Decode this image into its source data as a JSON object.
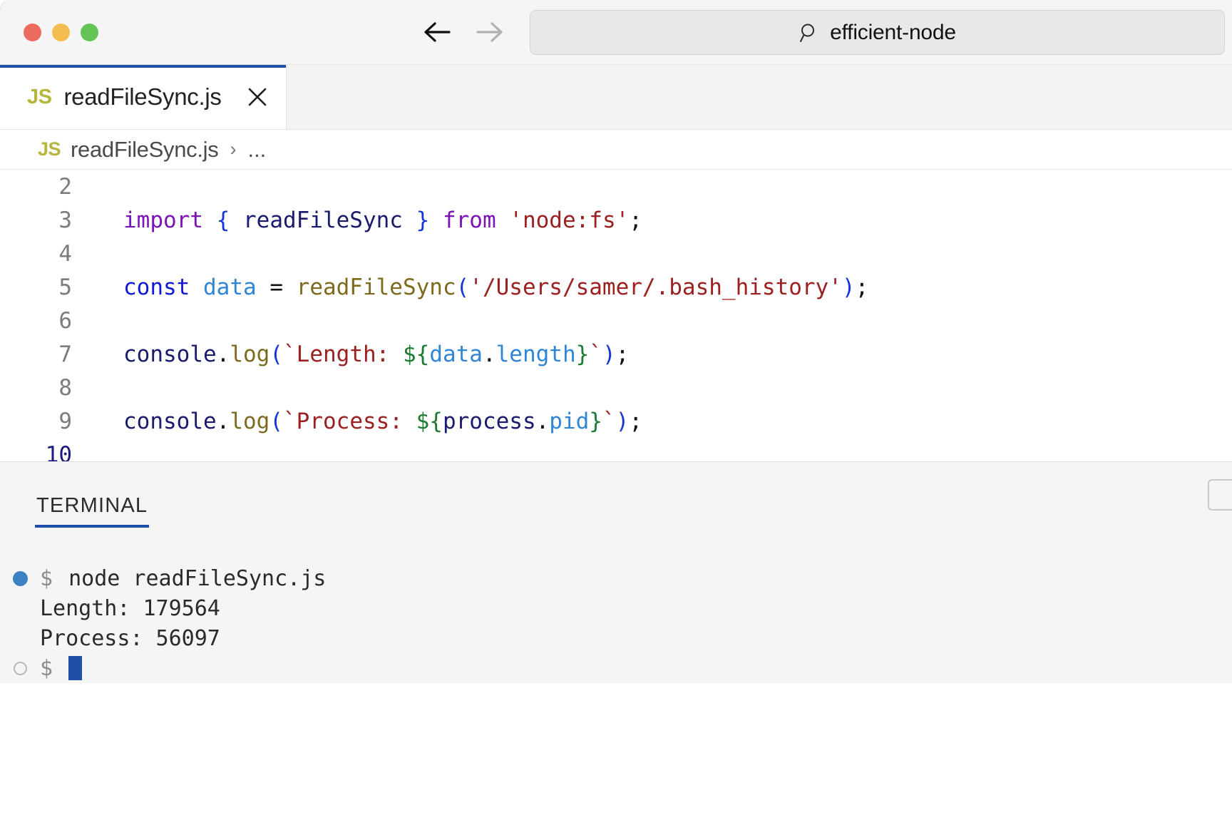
{
  "window": {
    "traffic_lights": [
      "close",
      "minimize",
      "maximize"
    ],
    "colors": {
      "close": "#ed6a5e",
      "minimize": "#f4bd4f",
      "maximize": "#61c454",
      "accent_blue": "#1f4fa8",
      "js_badge": "#b5b63b"
    }
  },
  "toolbar": {
    "back_icon": "arrow-left-icon",
    "forward_icon": "arrow-right-icon",
    "search": {
      "icon": "search-icon",
      "value": "efficient-node",
      "placeholder": "Search"
    }
  },
  "tabs": [
    {
      "icon_label": "JS",
      "label": "readFileSync.js",
      "close_icon": "close-icon",
      "active": true
    }
  ],
  "breadcrumb": {
    "icon_label": "JS",
    "file": "readFileSync.js",
    "separator": "›",
    "overflow": "..."
  },
  "editor": {
    "lines": [
      {
        "number": "2",
        "active": false,
        "tokens": []
      },
      {
        "number": "3",
        "active": false,
        "tokens": [
          {
            "t": "import",
            "c": "kw"
          },
          {
            "t": " ",
            "c": "plain"
          },
          {
            "t": "{",
            "c": "brace"
          },
          {
            "t": " ",
            "c": "plain"
          },
          {
            "t": "readFileSync",
            "c": "ident"
          },
          {
            "t": " ",
            "c": "plain"
          },
          {
            "t": "}",
            "c": "brace"
          },
          {
            "t": " ",
            "c": "plain"
          },
          {
            "t": "from",
            "c": "kw"
          },
          {
            "t": " ",
            "c": "plain"
          },
          {
            "t": "'node:fs'",
            "c": "str"
          },
          {
            "t": ";",
            "c": "plain"
          }
        ]
      },
      {
        "number": "4",
        "active": false,
        "tokens": []
      },
      {
        "number": "5",
        "active": false,
        "tokens": [
          {
            "t": "const",
            "c": "kw2"
          },
          {
            "t": " ",
            "c": "plain"
          },
          {
            "t": "data",
            "c": "var"
          },
          {
            "t": " = ",
            "c": "plain"
          },
          {
            "t": "readFileSync",
            "c": "fn"
          },
          {
            "t": "(",
            "c": "brace"
          },
          {
            "t": "'/Users/samer/.bash_history'",
            "c": "str"
          },
          {
            "t": ")",
            "c": "brace"
          },
          {
            "t": ";",
            "c": "plain"
          }
        ]
      },
      {
        "number": "6",
        "active": false,
        "tokens": []
      },
      {
        "number": "7",
        "active": false,
        "tokens": [
          {
            "t": "console",
            "c": "ident"
          },
          {
            "t": ".",
            "c": "plain"
          },
          {
            "t": "log",
            "c": "fn"
          },
          {
            "t": "(",
            "c": "brace"
          },
          {
            "t": "`Length: ",
            "c": "tpl"
          },
          {
            "t": "${",
            "c": "interp"
          },
          {
            "t": "data",
            "c": "prop"
          },
          {
            "t": ".",
            "c": "plain"
          },
          {
            "t": "length",
            "c": "prop"
          },
          {
            "t": "}",
            "c": "interp"
          },
          {
            "t": "`",
            "c": "tpl"
          },
          {
            "t": ")",
            "c": "brace"
          },
          {
            "t": ";",
            "c": "plain"
          }
        ]
      },
      {
        "number": "8",
        "active": false,
        "tokens": []
      },
      {
        "number": "9",
        "active": false,
        "tokens": [
          {
            "t": "console",
            "c": "ident"
          },
          {
            "t": ".",
            "c": "plain"
          },
          {
            "t": "log",
            "c": "fn"
          },
          {
            "t": "(",
            "c": "brace"
          },
          {
            "t": "`Process: ",
            "c": "tpl"
          },
          {
            "t": "${",
            "c": "interp"
          },
          {
            "t": "process",
            "c": "ident"
          },
          {
            "t": ".",
            "c": "plain"
          },
          {
            "t": "pid",
            "c": "prop"
          },
          {
            "t": "}",
            "c": "interp"
          },
          {
            "t": "`",
            "c": "tpl"
          },
          {
            "t": ")",
            "c": "brace"
          },
          {
            "t": ";",
            "c": "plain"
          }
        ]
      },
      {
        "number": "10",
        "active": true,
        "tokens": []
      }
    ]
  },
  "panel": {
    "tabs": [
      {
        "label": "TERMINAL",
        "active": true
      }
    ],
    "terminal": {
      "lines": [
        {
          "bullet": "filled",
          "prompt": "$",
          "command": "node readFileSync.js",
          "output": null,
          "cursor": false
        },
        {
          "bullet": "none",
          "prompt": null,
          "command": null,
          "output": "Length: 179564",
          "cursor": false
        },
        {
          "bullet": "none",
          "prompt": null,
          "command": null,
          "output": "Process: 56097",
          "cursor": false
        },
        {
          "bullet": "hollow",
          "prompt": "$",
          "command": "",
          "output": null,
          "cursor": true
        }
      ]
    }
  }
}
